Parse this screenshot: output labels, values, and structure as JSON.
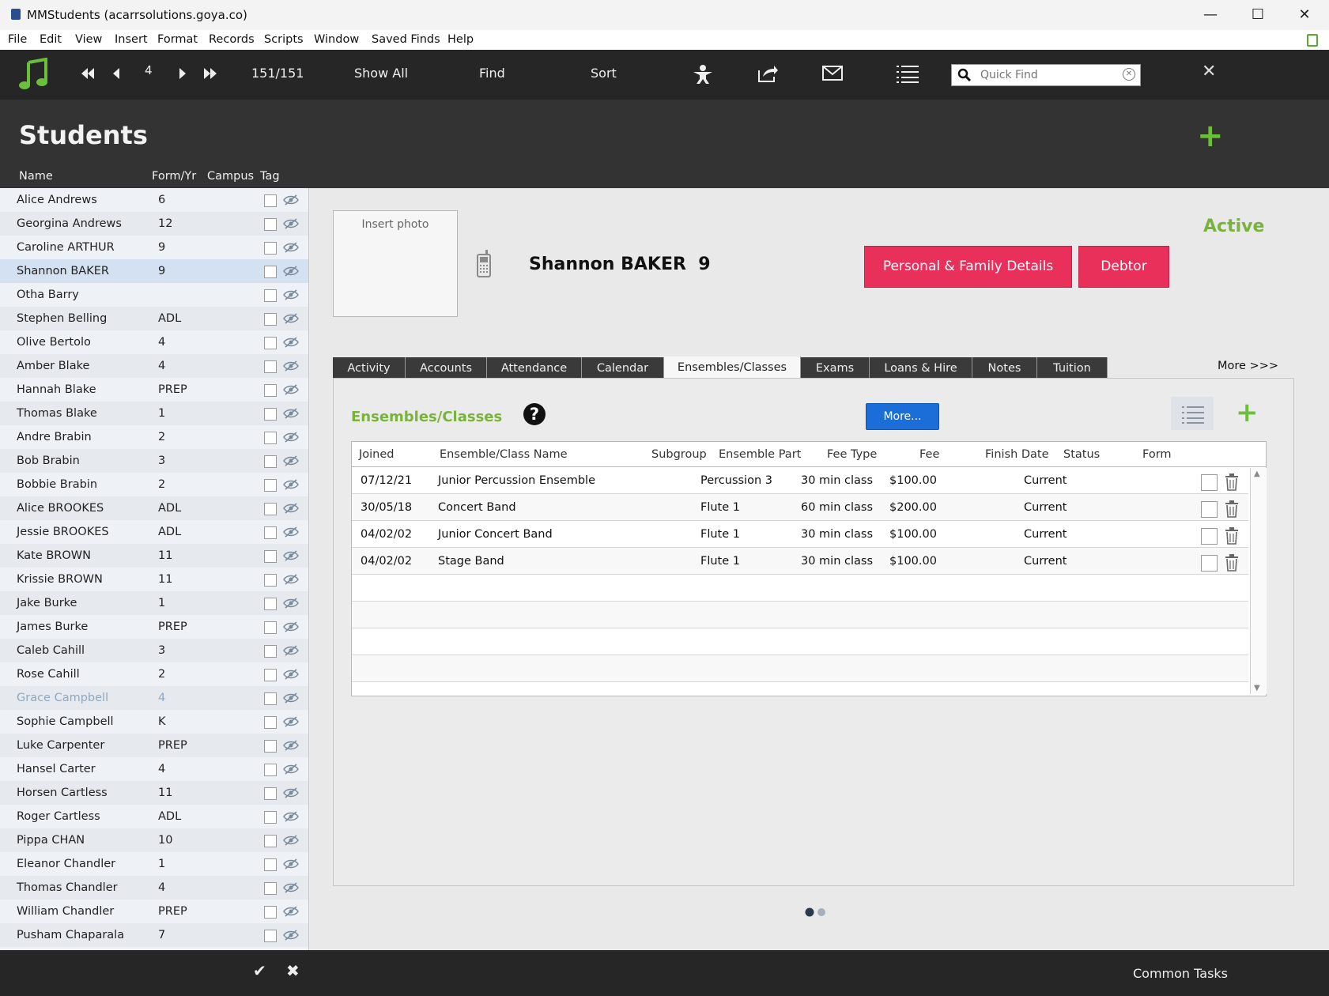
{
  "window": {
    "title": "MMStudents (acarrsolutions.goya.co)"
  },
  "menu": [
    "File",
    "Edit",
    "View",
    "Insert",
    "Format",
    "Records",
    "Scripts",
    "Window",
    "Saved Finds",
    "Help"
  ],
  "toolbar": {
    "record_number": "4",
    "record_count": "151/151",
    "show_all": "Show All",
    "find": "Find",
    "sort": "Sort",
    "quick_find_placeholder": "Quick Find"
  },
  "header": {
    "title": "Students",
    "columns": {
      "name": "Name",
      "form": "Form/Yr",
      "campus": "Campus",
      "tag": "Tag"
    }
  },
  "students": [
    {
      "name": "Alice Andrews",
      "form": "6"
    },
    {
      "name": "Georgina Andrews",
      "form": "12"
    },
    {
      "name": "Caroline ARTHUR",
      "form": "9"
    },
    {
      "name": "Shannon BAKER",
      "form": "9",
      "selected": true
    },
    {
      "name": "Otha Barry",
      "form": ""
    },
    {
      "name": "Stephen Belling",
      "form": "ADL"
    },
    {
      "name": "Olive Bertolo",
      "form": "4"
    },
    {
      "name": "Amber Blake",
      "form": "4"
    },
    {
      "name": "Hannah Blake",
      "form": "PREP"
    },
    {
      "name": "Thomas Blake",
      "form": "1"
    },
    {
      "name": "Andre Brabin",
      "form": "2"
    },
    {
      "name": "Bob Brabin",
      "form": "3"
    },
    {
      "name": "Bobbie Brabin",
      "form": "2"
    },
    {
      "name": "Alice BROOKES",
      "form": "ADL"
    },
    {
      "name": "Jessie BROOKES",
      "form": "ADL"
    },
    {
      "name": "Kate BROWN",
      "form": "11"
    },
    {
      "name": "Krissie BROWN",
      "form": "11"
    },
    {
      "name": "Jake Burke",
      "form": "1"
    },
    {
      "name": "James Burke",
      "form": "PREP"
    },
    {
      "name": "Caleb Cahill",
      "form": "3"
    },
    {
      "name": "Rose Cahill",
      "form": "2"
    },
    {
      "name": "Grace Campbell",
      "form": "4",
      "inactive": true
    },
    {
      "name": "Sophie Campbell",
      "form": "K"
    },
    {
      "name": "Luke Carpenter",
      "form": "PREP"
    },
    {
      "name": "Hansel Carter",
      "form": "4"
    },
    {
      "name": "Horsen Cartless",
      "form": "11"
    },
    {
      "name": "Roger Cartless",
      "form": "ADL"
    },
    {
      "name": "Pippa CHAN",
      "form": "10"
    },
    {
      "name": "Eleanor Chandler",
      "form": "1"
    },
    {
      "name": "Thomas Chandler",
      "form": "4"
    },
    {
      "name": "William Chandler",
      "form": "PREP"
    },
    {
      "name": "Pusham Chaparala",
      "form": "7"
    }
  ],
  "detail": {
    "photo_placeholder": "Insert photo",
    "student_name": "Shannon BAKER",
    "student_form": "9",
    "status": "Active",
    "personal_button": "Personal & Family Details",
    "debtor_button": "Debtor",
    "tabs": [
      "Activity",
      "Accounts",
      "Attendance",
      "Calendar",
      "Ensembles/Classes",
      "Exams",
      "Loans & Hire",
      "Notes",
      "Tuition"
    ],
    "selected_tab": "Ensembles/Classes",
    "more_tabs": "More >>>"
  },
  "ensembles": {
    "title": "Ensembles/Classes",
    "help": "?",
    "more_button": "More...",
    "columns": [
      "Joined",
      "Ensemble/Class Name",
      "Subgroup",
      "Ensemble Part",
      "Fee Type",
      "Fee",
      "Finish Date",
      "Status",
      "Form"
    ],
    "rows": [
      {
        "joined": "07/12/21",
        "name": "Junior Percussion Ensemble",
        "subgroup": "",
        "part": "Percussion 3",
        "fee_type": "30 min class",
        "fee": "$100.00",
        "finish": "",
        "status": "Current",
        "form": ""
      },
      {
        "joined": "30/05/18",
        "name": "Concert Band",
        "subgroup": "",
        "part": "Flute 1",
        "fee_type": "60 min class",
        "fee": "$200.00",
        "finish": "",
        "status": "Current",
        "form": ""
      },
      {
        "joined": "04/02/02",
        "name": "Junior Concert Band",
        "subgroup": "",
        "part": "Flute 1",
        "fee_type": "30 min class",
        "fee": "$100.00",
        "finish": "",
        "status": "Current",
        "form": ""
      },
      {
        "joined": "04/02/02",
        "name": "Stage Band",
        "subgroup": "",
        "part": "Flute 1",
        "fee_type": "30 min class",
        "fee": "$100.00",
        "finish": "",
        "status": "Current",
        "form": ""
      }
    ]
  },
  "bottom": {
    "confirm_icon": "check-icon",
    "cancel_icon": "cross-icon",
    "common_tasks": "Common Tasks"
  },
  "colors": {
    "accent_green": "#7ab33b",
    "pink": "#e8305b",
    "blue": "#1b6ed8",
    "toolbar_dark": "#262626"
  },
  "icons": [
    "music-note-icon",
    "first-record-icon",
    "prev-record-icon",
    "next-record-icon",
    "last-record-icon",
    "person-icon",
    "export-icon",
    "mail-icon",
    "list-icon",
    "search-icon",
    "clear-icon",
    "close-icon",
    "add-icon",
    "phone-icon",
    "help-icon",
    "trash-icon",
    "eye-slash-icon"
  ]
}
